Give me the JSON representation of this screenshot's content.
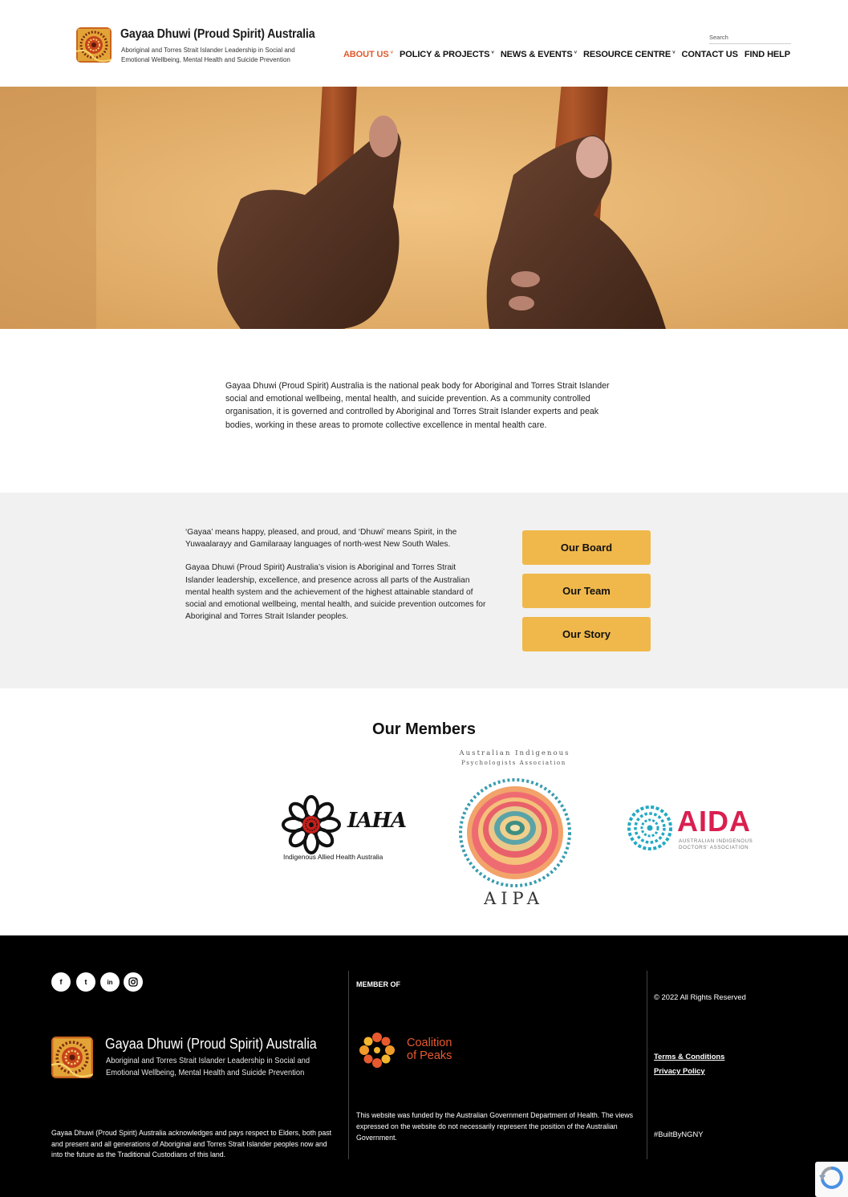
{
  "header": {
    "brand_title": "Gayaa Dhuwi (Proud Spirit) Australia",
    "brand_subtitle": "Aboriginal and Torres Strait Islander Leadership in Social and Emotional Wellbeing, Mental Health and Suicide Prevention",
    "search_placeholder": "Search",
    "nav": [
      {
        "label": "ABOUT US",
        "has_dropdown": true,
        "active": true
      },
      {
        "label": "POLICY & PROJECTS",
        "has_dropdown": true,
        "active": false
      },
      {
        "label": "NEWS & EVENTS",
        "has_dropdown": true,
        "active": false
      },
      {
        "label": "RESOURCE CENTRE",
        "has_dropdown": true,
        "active": false
      },
      {
        "label": "CONTACT US",
        "has_dropdown": false,
        "active": false
      },
      {
        "label": "FIND HELP",
        "has_dropdown": false,
        "active": false
      }
    ],
    "caret": "˅",
    "active_color": "#e05a2b"
  },
  "intro": {
    "text": "Gayaa Dhuwi (Proud Spirit) Australia is the national peak body for Aboriginal and Torres Strait Islander social and emotional wellbeing, mental health, and suicide prevention. As a community controlled organisation, it is governed and controlled by Aboriginal and Torres Strait Islander experts and peak bodies, working in these areas to promote collective excellence in mental health care."
  },
  "about": {
    "paragraph_1": "‘Gayaa’ means happy, pleased, and proud, and ‘Dhuwi’ means Spirit, in the Yuwaalarayy and Gamilaraay languages of north-west New South Wales.",
    "paragraph_2": "Gayaa Dhuwi (Proud Spirit) Australia’s vision is Aboriginal and Torres Strait Islander leadership, excellence, and presence across all parts of the Australian mental health system and the achievement of the highest attainable standard of social and emotional wellbeing, mental health, and suicide prevention outcomes for Aboriginal and Torres Strait Islander peoples.",
    "buttons": [
      "Our Board",
      "Our Team",
      "Our Story"
    ],
    "button_color": "#f0b84b"
  },
  "members": {
    "title": "Our Members",
    "iaha": {
      "name": "IAHA",
      "caption": "Indigenous Allied Health Australia"
    },
    "aipa": {
      "top_line_1": "Australian Indigenous",
      "top_line_2": "Psychologists Association",
      "name": "AIPA"
    },
    "aida": {
      "name": "AIDA",
      "caption_1": "AUSTRALIAN INDIGENOUS",
      "caption_2": "DOCTORS' ASSOCIATION",
      "color": "#d91f4f"
    }
  },
  "footer": {
    "social": [
      "f",
      "t",
      "in",
      "ig"
    ],
    "social_icons": [
      "facebook-icon",
      "twitter-icon",
      "linkedin-icon",
      "instagram-icon"
    ],
    "brand_title": "Gayaa Dhuwi (Proud Spirit) Australia",
    "brand_subtitle": "Aboriginal and Torres Strait Islander Leadership in Social and Emotional Wellbeing, Mental Health and Suicide Prevention",
    "acknowledgement": "Gayaa Dhuwi (Proud Spirit) Australia acknowledges and pays respect to Elders, both past and present and all generations of Aboriginal and Torres Strait Islander peoples now and into the future as the Traditional Custodians of this land.",
    "member_of_label": "MEMBER OF",
    "coalition_line_1": "Coalition",
    "coalition_line_2": "of Peaks",
    "coalition_color": "#e75a2e",
    "funding_notice": "This website was funded by the Australian Government Department of Health. The views expressed on the website do not necessarily represent the position of the Australian Government.",
    "copyright": "© 2022 All Rights Reserved",
    "terms": "Terms & Conditions",
    "privacy": "Privacy Policy",
    "built_by": "#BuiltByNGNY"
  }
}
